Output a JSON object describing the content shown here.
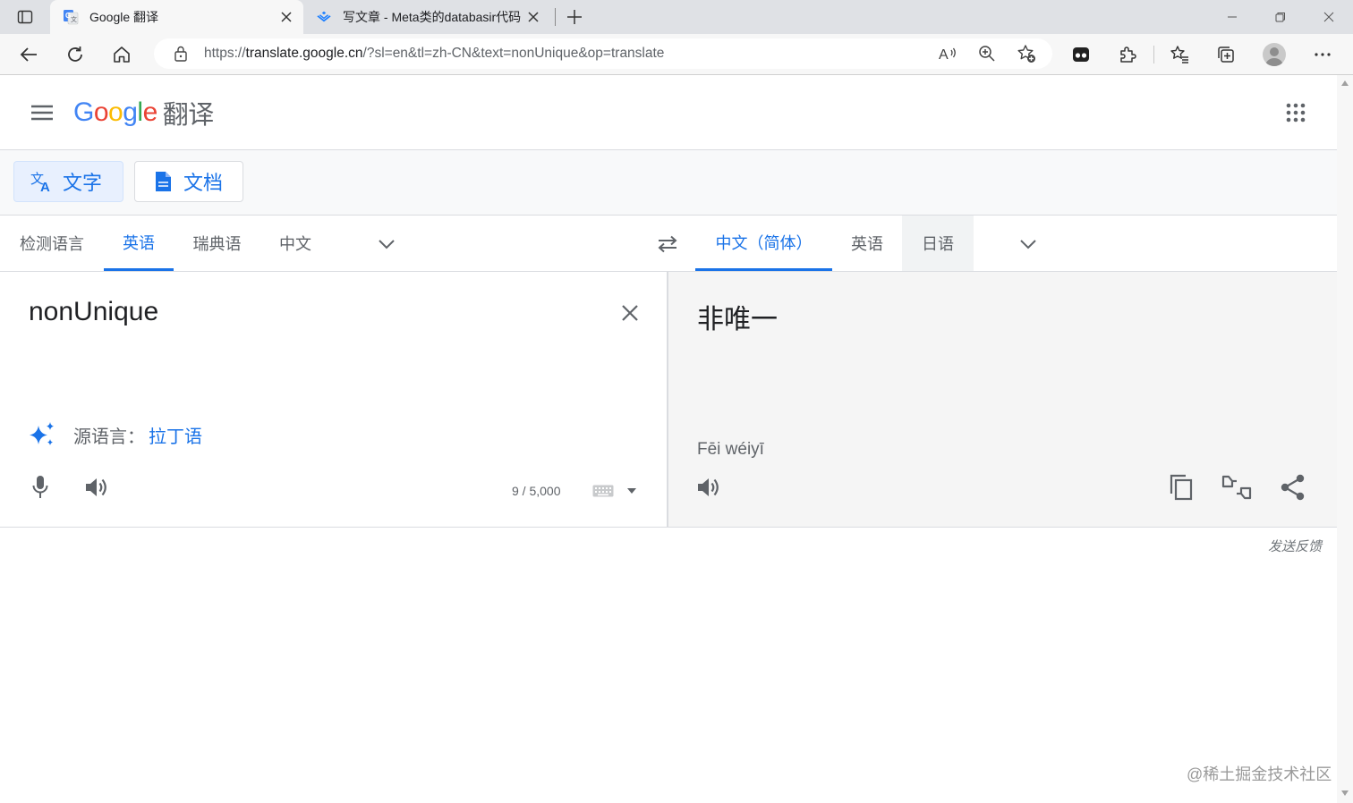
{
  "browser": {
    "tabs": [
      {
        "title": "Google 翻译",
        "active": true,
        "favicon": "google-translate-icon"
      },
      {
        "title": "写文章 - Meta类的databasir代码",
        "active": false,
        "favicon": "juejin-icon"
      }
    ],
    "address_bar": {
      "url_prefix": "https://",
      "url_host": "translate.google.cn",
      "url_rest": "/?sl=en&tl=zh-CN&text=nonUnique&op=translate"
    }
  },
  "app": {
    "product_name": "翻译",
    "logo_letters": [
      "G",
      "o",
      "o",
      "g",
      "l",
      "e"
    ]
  },
  "modes": [
    {
      "label": "文字",
      "active": true,
      "icon": "translate-icon"
    },
    {
      "label": "文档",
      "active": false,
      "icon": "document-icon"
    }
  ],
  "source_languages": [
    "检测语言",
    "英语",
    "瑞典语",
    "中文"
  ],
  "source_selected": "英语",
  "target_languages": [
    "中文（简体）",
    "英语",
    "日语"
  ],
  "target_selected": "中文（简体）",
  "source": {
    "text": "nonUnique",
    "detect_label": "源语言：",
    "detect_lang": "拉丁语",
    "char_count": "9 / 5,000"
  },
  "target": {
    "text": "非唯一",
    "romanization": "Fēi wéiyī"
  },
  "feedback_label": "发送反馈",
  "watermark": "@稀土掘金技术社区",
  "colors": {
    "accent": "#1a73e8",
    "google_blue": "#4285f4",
    "google_red": "#ea4335",
    "google_yellow": "#fbbc04",
    "google_green": "#34a853"
  }
}
